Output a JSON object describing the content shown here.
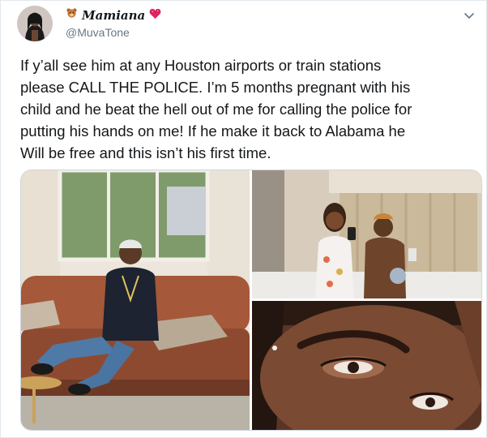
{
  "author": {
    "display_name": "Mamiana",
    "handle": "@MuvaTone",
    "name_decor_left": "teddy-bear-emoji",
    "name_decor_right": "heart-emoji",
    "avatar": "avatar-photo"
  },
  "tweet": {
    "text": "If y’all see him at any Houston airports or train stations\nplease CALL THE POLICE. I’m 5 months pregnant with his\nchild and he beat the hell out of me for calling the police for\nputting his hands on me! If he make it back to Alabama he\nWill be free and this isn’t his first time."
  },
  "menu": {
    "icon": "chevron-down-icon"
  },
  "media": {
    "count": 3,
    "items": [
      {
        "icon": "photo-man-on-couch"
      },
      {
        "icon": "photo-couple-selfie"
      },
      {
        "icon": "photo-bruised-eye"
      }
    ]
  },
  "colors": {
    "text": "#14171a",
    "secondary": "#657786",
    "border": "#e1e8ed"
  }
}
